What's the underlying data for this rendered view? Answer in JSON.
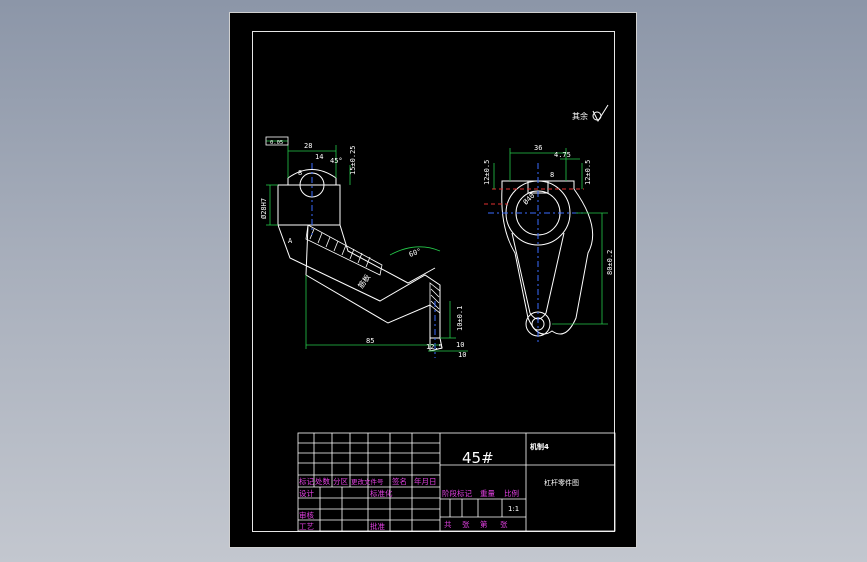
{
  "drawing": {
    "roughness_note": "其余",
    "material": "45#",
    "designer_tag": "机制4",
    "part_name": "杠杆零件图",
    "scale": "1:1",
    "side_view_dims": {
      "overall_length": "85",
      "hole_dia": "Ø28H7",
      "top_width": "28",
      "top_small": "14",
      "height_top": "15±0.25",
      "angle": "60°",
      "small_dim": "10±0.1",
      "bottom_left": "12.5",
      "bottom_width": "10",
      "rib_label": "筋板",
      "thickness": "8",
      "datum_box": "0.05",
      "mark_a": "A",
      "right_small": "10",
      "top_angle": "45°"
    },
    "front_view_dims": {
      "width": "36",
      "left_h": "12±0.5",
      "right_h": "12±0.5",
      "small_right": "4.75",
      "center": "Ø40",
      "length": "80±0.2",
      "slot": "8"
    },
    "title_block": {
      "row_labels": [
        "标记",
        "处数",
        "分区",
        "更改文件号",
        "签名",
        "年月日"
      ],
      "design": "设计",
      "check": "审核",
      "craft": "工艺",
      "standard": "标准化",
      "approve": "批准",
      "stage": "阶段标记",
      "weight": "重量",
      "ratio": "比例",
      "total": "共",
      "sheets": "张",
      "page": "第",
      "sheet_unit": "张"
    }
  }
}
